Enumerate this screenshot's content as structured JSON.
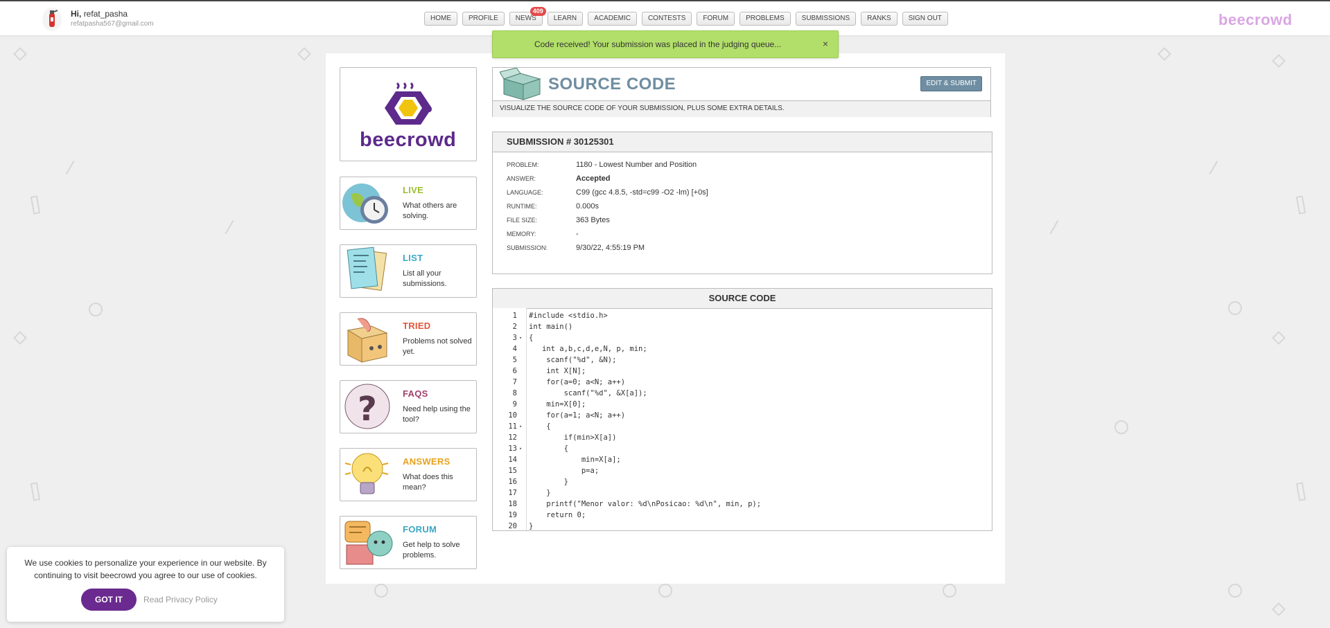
{
  "user": {
    "greeting_prefix": "Hi,",
    "username": "refat_pasha",
    "email": "refatpasha567@gmail.com"
  },
  "nav": [
    {
      "label": "HOME"
    },
    {
      "label": "PROFILE"
    },
    {
      "label": "NEWS",
      "badge": "409"
    },
    {
      "label": "LEARN"
    },
    {
      "label": "ACADEMIC"
    },
    {
      "label": "CONTESTS"
    },
    {
      "label": "FORUM"
    },
    {
      "label": "PROBLEMS"
    },
    {
      "label": "SUBMISSIONS"
    },
    {
      "label": "RANKS"
    },
    {
      "label": "SIGN OUT"
    }
  ],
  "brand": "beecrowd",
  "toast": {
    "message": "Code received! Your submission was placed in the judging queue...",
    "close": "×"
  },
  "logo_text": "beecrowd",
  "sidebar": [
    {
      "title": "LIVE",
      "desc": "What others are solving.",
      "color": "#9bbf2f",
      "icon": "globe-clock-icon"
    },
    {
      "title": "LIST",
      "desc": "List all your submissions.",
      "color": "#3aa7c5",
      "icon": "papers-icon"
    },
    {
      "title": "TRIED",
      "desc": "Problems not solved yet.",
      "color": "#e2553a",
      "icon": "box-icon"
    },
    {
      "title": "FAQS",
      "desc": "Need help using the tool?",
      "color": "#a33f6a",
      "icon": "question-icon"
    },
    {
      "title": "ANSWERS",
      "desc": "What does this mean?",
      "color": "#e8a21c",
      "icon": "lightbulb-icon"
    },
    {
      "title": "FORUM",
      "desc": "Get help to solve problems.",
      "color": "#3aa7c5",
      "icon": "chat-icon"
    }
  ],
  "header": {
    "title": "SOURCE CODE",
    "edit_button": "EDIT & SUBMIT",
    "subtitle": "VISUALIZE THE SOURCE CODE OF YOUR SUBMISSION, PLUS SOME EXTRA DETAILS."
  },
  "submission": {
    "heading": "SUBMISSION # 30125301",
    "rows": [
      {
        "key": "PROBLEM:",
        "value": "1180 - Lowest Number and Position"
      },
      {
        "key": "ANSWER:",
        "value": "Accepted"
      },
      {
        "key": "LANGUAGE:",
        "value": "C99 (gcc 4.8.5, -std=c99 -O2 -lm) [+0s]"
      },
      {
        "key": "RUNTIME:",
        "value": "0.000s"
      },
      {
        "key": "FILE SIZE:",
        "value": "363 Bytes"
      },
      {
        "key": "MEMORY:",
        "value": "-"
      },
      {
        "key": "SUBMISSION:",
        "value": "9/30/22, 4:55:19 PM"
      }
    ]
  },
  "code": {
    "heading": "SOURCE CODE",
    "lines": [
      {
        "n": "1",
        "fold": "",
        "text": "#include <stdio.h>"
      },
      {
        "n": "2",
        "fold": "",
        "text": "int main()"
      },
      {
        "n": "3",
        "fold": "▾",
        "text": "{"
      },
      {
        "n": "4",
        "fold": "",
        "text": "   int a,b,c,d,e,N, p, min;"
      },
      {
        "n": "5",
        "fold": "",
        "text": "    scanf(\"%d\", &N);"
      },
      {
        "n": "6",
        "fold": "",
        "text": "    int X[N];"
      },
      {
        "n": "7",
        "fold": "",
        "text": "    for(a=0; a<N; a++)"
      },
      {
        "n": "8",
        "fold": "",
        "text": "        scanf(\"%d\", &X[a]);"
      },
      {
        "n": "9",
        "fold": "",
        "text": "    min=X[0];"
      },
      {
        "n": "10",
        "fold": "",
        "text": "    for(a=1; a<N; a++)"
      },
      {
        "n": "11",
        "fold": "▾",
        "text": "    {"
      },
      {
        "n": "12",
        "fold": "",
        "text": "        if(min>X[a])"
      },
      {
        "n": "13",
        "fold": "▾",
        "text": "        {"
      },
      {
        "n": "14",
        "fold": "",
        "text": "            min=X[a];"
      },
      {
        "n": "15",
        "fold": "",
        "text": "            p=a;"
      },
      {
        "n": "16",
        "fold": "",
        "text": "        }"
      },
      {
        "n": "17",
        "fold": "",
        "text": "    }"
      },
      {
        "n": "18",
        "fold": "",
        "text": "    printf(\"Menor valor: %d\\nPosicao: %d\\n\", min, p);"
      },
      {
        "n": "19",
        "fold": "",
        "text": "    return 0;"
      },
      {
        "n": "20",
        "fold": "",
        "text": "}"
      }
    ]
  },
  "cookie": {
    "text": "We use cookies to personalize your experience in our website. By continuing to visit beecrowd you agree to our use of cookies.",
    "accept": "GOT IT",
    "privacy": "Read Privacy Policy"
  }
}
